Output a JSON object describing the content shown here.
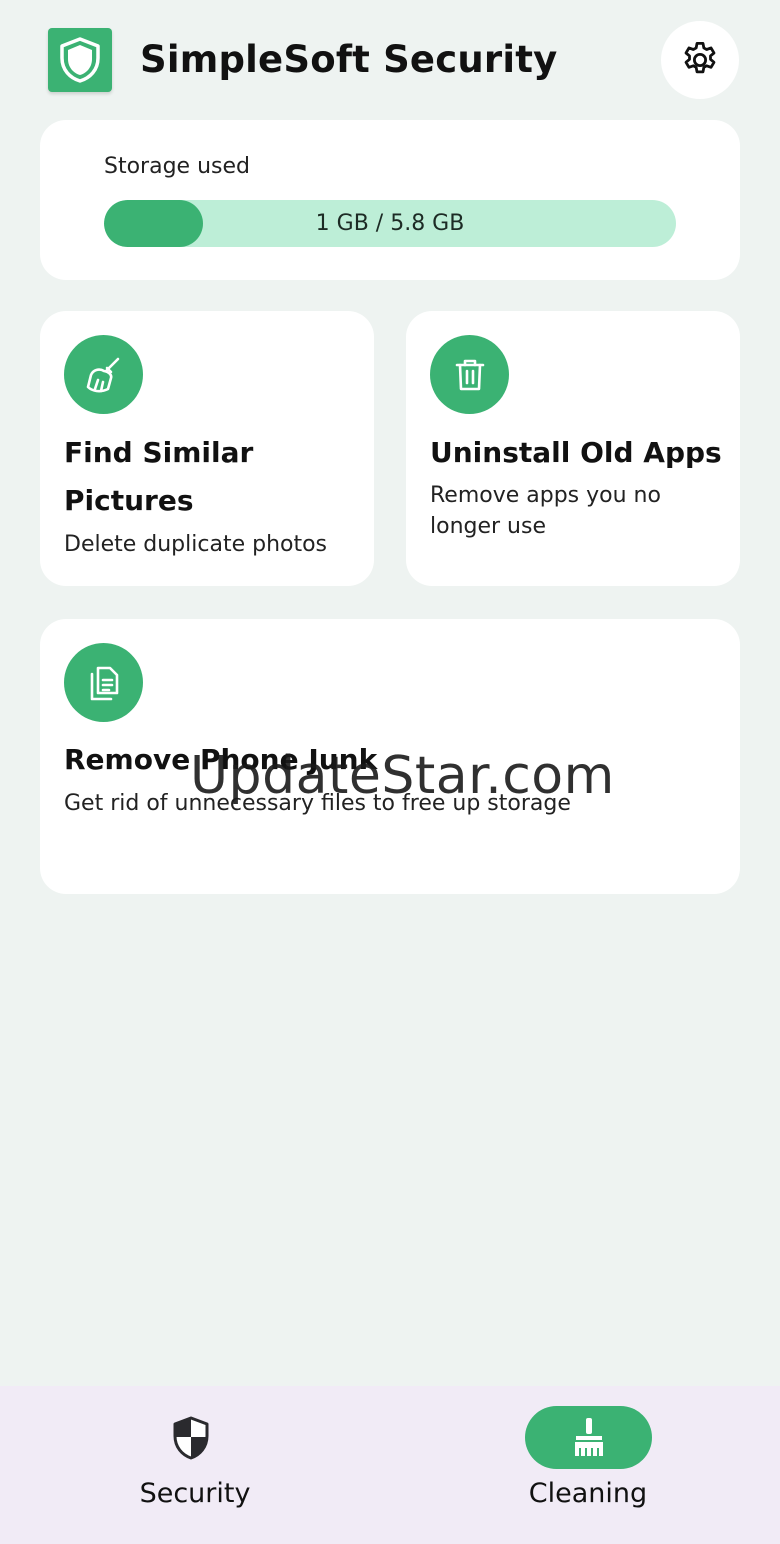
{
  "header": {
    "app_title": "SimpleSoft Security",
    "logo_icon": "shield-icon",
    "settings_icon": "gear-icon"
  },
  "storage": {
    "label": "Storage used",
    "usage_text": "1 GB / 5.8 GB",
    "used_gb": 1,
    "total_gb": 5.8,
    "used_fraction": 0.1724
  },
  "cards": [
    {
      "title": "Find Similar Pictures",
      "description": "Delete duplicate photos",
      "icon": "broom-icon"
    },
    {
      "title": "Uninstall Old Apps",
      "description": "Remove apps you no longer use",
      "icon": "trash-icon"
    },
    {
      "title": "Remove Phone Junk",
      "description": "Get rid of unnecessary files to free up storage",
      "icon": "files-icon"
    }
  ],
  "watermark": "UpdateStar.com",
  "bottom_nav": {
    "items": [
      {
        "label": "Security",
        "icon": "shield-half-icon",
        "active": false
      },
      {
        "label": "Cleaning",
        "icon": "broom-icon",
        "active": true
      }
    ]
  },
  "colors": {
    "accent": "#3bb273",
    "accent_light": "#bdeed7",
    "background": "#eef3f1",
    "nav_background": "#f1ebf6"
  }
}
